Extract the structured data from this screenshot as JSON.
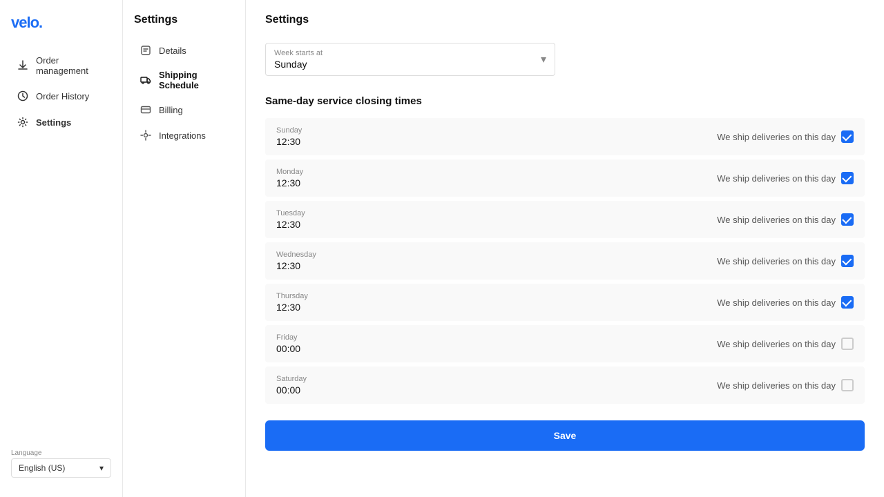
{
  "logo": {
    "text": "velo.",
    "color": "#1a6cf5"
  },
  "sidebar": {
    "items": [
      {
        "id": "order-management",
        "label": "Order management",
        "icon": "download-icon"
      },
      {
        "id": "order-history",
        "label": "Order History",
        "icon": "clock-icon"
      },
      {
        "id": "settings",
        "label": "Settings",
        "icon": "gear-icon",
        "active": true
      }
    ]
  },
  "settings_nav": {
    "title": "Settings",
    "items": [
      {
        "id": "details",
        "label": "Details",
        "icon": "details-icon"
      },
      {
        "id": "shipping-schedule",
        "label": "Shipping Schedule",
        "icon": "truck-icon",
        "active": true
      },
      {
        "id": "billing",
        "label": "Billing",
        "icon": "card-icon"
      },
      {
        "id": "integrations",
        "label": "Integrations",
        "icon": "circle-icon"
      }
    ]
  },
  "page": {
    "title": "Settings",
    "week_starts_label": "Week starts at",
    "week_starts_value": "Sunday",
    "same_day_title": "Same-day service closing times",
    "days": [
      {
        "name": "Sunday",
        "time": "12:30",
        "checked": true
      },
      {
        "name": "Monday",
        "time": "12:30",
        "checked": true
      },
      {
        "name": "Tuesday",
        "time": "12:30",
        "checked": true
      },
      {
        "name": "Wednesday",
        "time": "12:30",
        "checked": true
      },
      {
        "name": "Thursday",
        "time": "12:30",
        "checked": true
      },
      {
        "name": "Friday",
        "time": "00:00",
        "checked": false
      },
      {
        "name": "Saturday",
        "time": "00:00",
        "checked": false
      }
    ],
    "checkbox_label": "We ship deliveries on this day",
    "save_label": "Save"
  },
  "language": {
    "label": "Language",
    "value": "English (US)"
  }
}
